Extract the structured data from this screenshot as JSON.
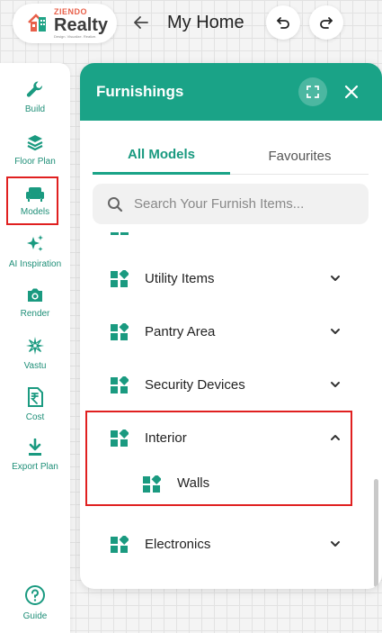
{
  "header": {
    "logo": {
      "top": "ZIENDO",
      "main": "Realty",
      "tagline": "Design. Visualize. Realize."
    },
    "back_icon": "arrow-left-icon",
    "title": "My Home",
    "undo_icon": "undo-icon",
    "redo_icon": "redo-icon"
  },
  "sidebar": {
    "items": [
      {
        "label": "Build",
        "icon": "wrench-icon"
      },
      {
        "label": "Floor Plan",
        "icon": "layers-icon"
      },
      {
        "label": "Models",
        "icon": "sofa-icon",
        "active": true
      },
      {
        "label": "AI Inspiration",
        "icon": "sparkles-icon"
      },
      {
        "label": "Render",
        "icon": "camera-icon"
      },
      {
        "label": "Vastu",
        "icon": "compass-icon"
      },
      {
        "label": "Cost",
        "icon": "rupee-doc-icon"
      },
      {
        "label": "Export Plan",
        "icon": "download-icon"
      },
      {
        "label": "Guide",
        "icon": "help-circle-icon"
      }
    ]
  },
  "panel": {
    "title": "Furnishings",
    "tabs": [
      {
        "label": "All Models",
        "active": true
      },
      {
        "label": "Favourites",
        "active": false
      }
    ],
    "search": {
      "placeholder": "Search Your Furnish Items..."
    },
    "categories": [
      {
        "label": "Utility Items",
        "expanded": false
      },
      {
        "label": "Pantry Area",
        "expanded": false
      },
      {
        "label": "Security Devices",
        "expanded": false
      },
      {
        "label": "Interior",
        "expanded": true,
        "children": [
          {
            "label": "Walls"
          }
        ]
      },
      {
        "label": "Electronics",
        "expanded": false
      }
    ]
  },
  "colors": {
    "accent": "#1aa387",
    "highlight": "#e02020",
    "logo_orange": "#e8604a"
  }
}
